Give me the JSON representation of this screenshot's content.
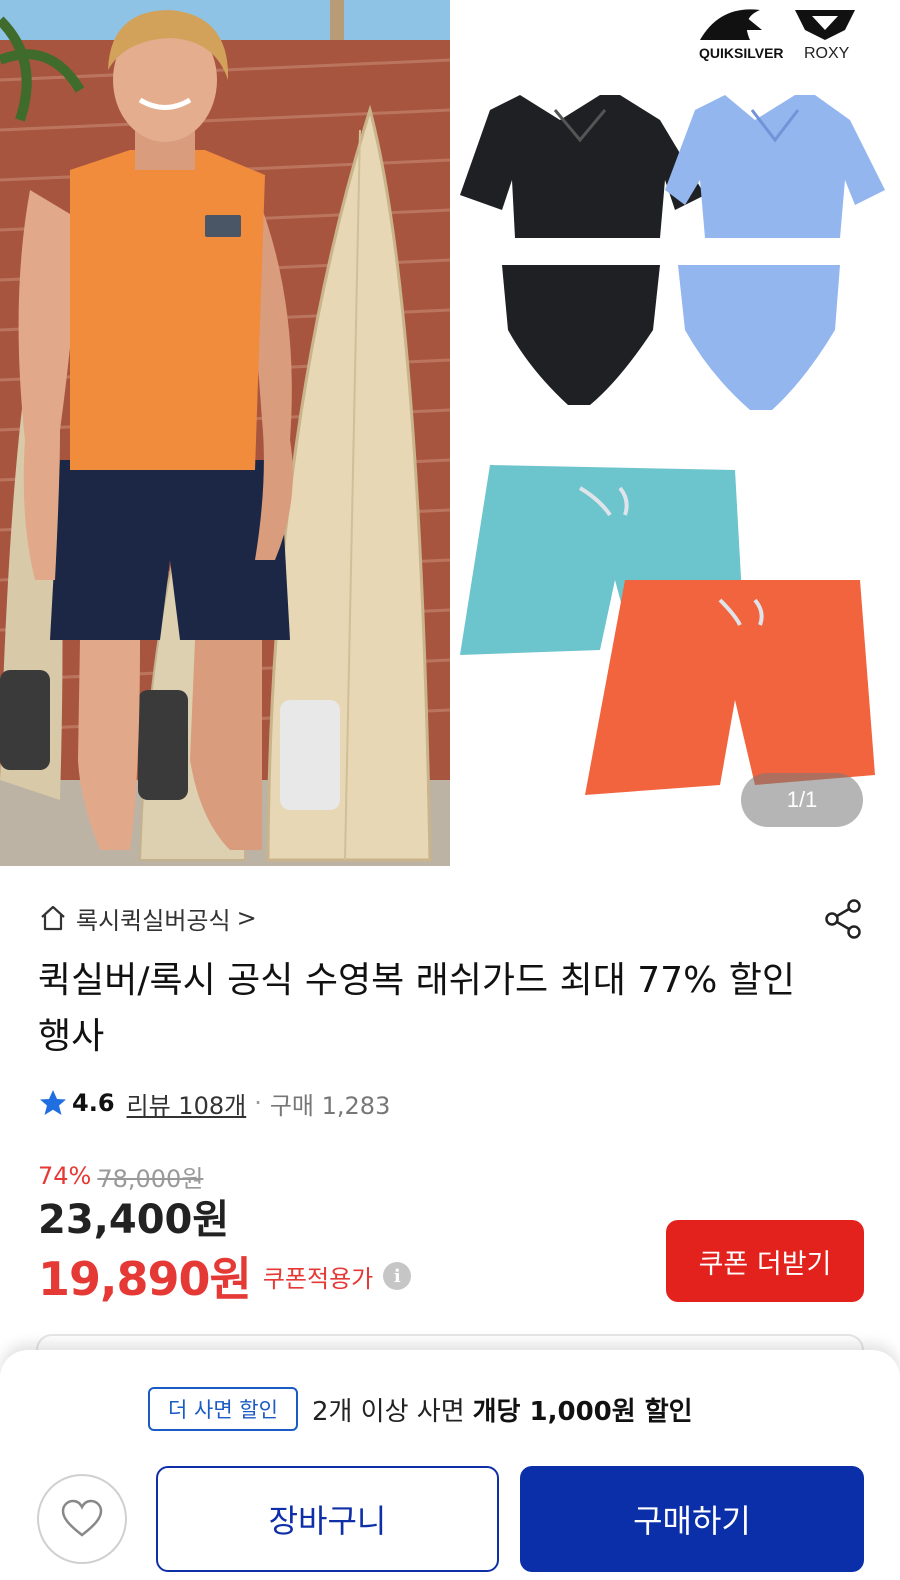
{
  "hero": {
    "brand_left": "QUIKSILVER",
    "brand_right": "ROXY",
    "counter": "1/1"
  },
  "store": {
    "icon": "home-icon",
    "name": "록시퀵실버공식",
    "chevron": ">"
  },
  "share_icon": "share-icon",
  "product": {
    "title": "퀵실버/록시 공식 수영복 래쉬가드 최대 77% 할인행사"
  },
  "rating": {
    "icon": "star-icon",
    "score": "4.6",
    "reviews": "리뷰 108개",
    "separator": "·",
    "purchases": "구매 1,283"
  },
  "price": {
    "discount_percent": "74%",
    "original": "78,000원",
    "sale": "23,400원",
    "coupon_price": "19,890원",
    "coupon_note": "쿠폰적용가",
    "info_icon": "i"
  },
  "coupon_button": "쿠폰 더받기",
  "promo": {
    "badge": "더 사면 할인",
    "text": "2개 이상 사면",
    "strong": "개당 1,000원 할인"
  },
  "actions": {
    "wish_icon": "heart-icon",
    "cart": "장바구니",
    "buy": "구매하기"
  },
  "colors": {
    "accent_red": "#e3221d",
    "price_red": "#e53935",
    "primary_blue": "#0a2fa8",
    "badge_blue": "#1a5bc4"
  }
}
